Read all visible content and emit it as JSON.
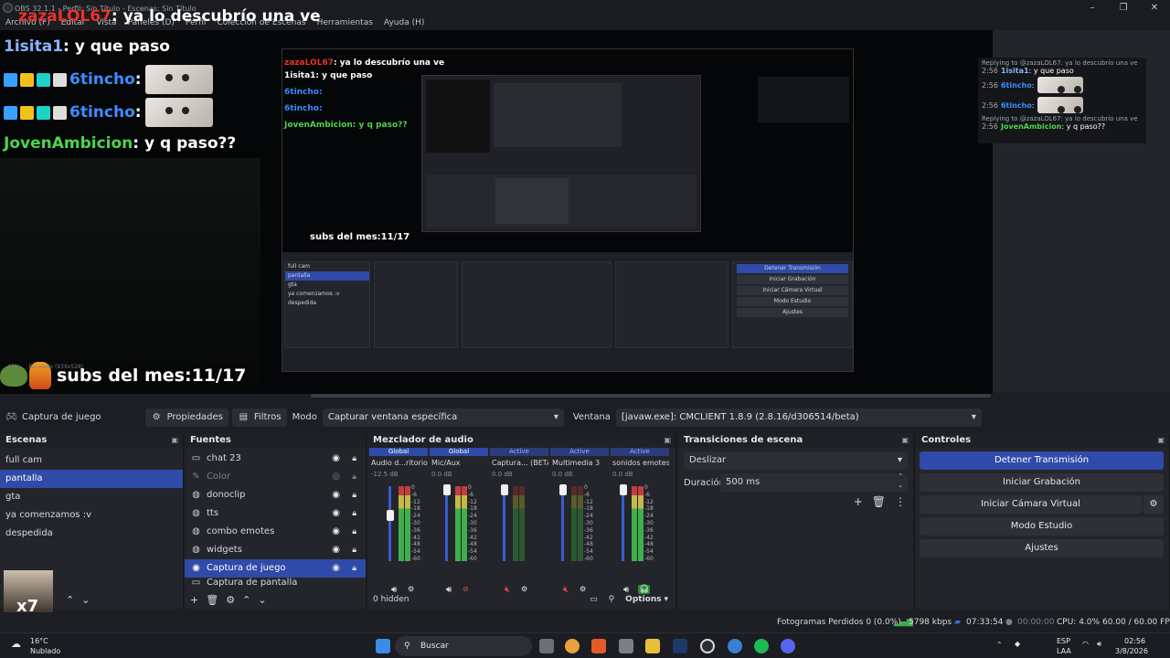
{
  "window": {
    "title": "OBS 32.1.1 - Perfil: Sin Título - Escenas: Sin Título"
  },
  "menu": [
    "Archivo (F)",
    "Editar",
    "Vista",
    "Paneles (D)",
    "Perfil",
    "Colección de Escenas",
    "Herramientas",
    "Ayuda (H)"
  ],
  "overlay": {
    "top_user": "zazaLOL67",
    "top_text": ": ya lo descubrío una ve",
    "chat": [
      {
        "user": "1isita1",
        "text": ": y que paso",
        "color": "#8ab4ff"
      },
      {
        "user": "6tincho",
        "text": ":",
        "color": "#3a8dff",
        "emote": true
      },
      {
        "user": "6tincho",
        "text": ":",
        "color": "#3a8dff",
        "emote": true
      },
      {
        "user": "JovenAmbicion",
        "text": ": y q paso??",
        "color": "#4fd34f"
      }
    ],
    "subs": "subs del mes:11/17"
  },
  "nested": {
    "chat": [
      "1isita1: y que paso",
      "6tincho:",
      "6tincho:",
      "JovenAmbicion: y q paso??"
    ],
    "subs": "subs del mes:11/17",
    "scenes": [
      "full cam",
      "pantalla",
      "gta",
      "ya comenzamos :v",
      "despedida"
    ],
    "controls": [
      "Detener Transmisión",
      "Iniciar Grabación",
      "Iniciar Cámara Virtual",
      "Modo Estudio",
      "Ajustes"
    ]
  },
  "right_chat": [
    {
      "reply": "Replying to @zazaLOL67: ya lo descubrío una ve"
    },
    {
      "time": "2:56",
      "user": "1isita1",
      "text": ": y que paso"
    },
    {
      "time": "2:56",
      "user": "6tincho",
      "text": ":"
    },
    {
      "time": "2:56",
      "user": "6tincho",
      "text": ":"
    },
    {
      "reply": "Replying to @zazaLOL67: ya lo descubrío una ve"
    },
    {
      "time": "2:56",
      "user": "JovenAmbicion",
      "text": ": y q paso??"
    }
  ],
  "preview_status": {
    "zoom": "48%",
    "scale": "Escalado (939x528)"
  },
  "toolbar": {
    "source_name": "Captura de juego",
    "properties": "Propiedades",
    "filters": "Filtros",
    "mode_label": "Modo",
    "mode_value": "Capturar ventana específica",
    "window_label": "Ventana",
    "window_value": "[javaw.exe]: CMCLIENT 1.8.9 (2.8.16/d306514/beta)"
  },
  "scenes": {
    "title": "Escenas",
    "items": [
      "full cam",
      "pantalla",
      "gta",
      "ya comenzamos :v",
      "despedida"
    ],
    "selected": 1,
    "webcam_label": "x7"
  },
  "sources": {
    "title": "Fuentes",
    "items": [
      {
        "name": "chat 23",
        "icon": "▭"
      },
      {
        "name": "Color",
        "icon": "✎"
      },
      {
        "name": "donoclip",
        "icon": "◍"
      },
      {
        "name": "tts",
        "icon": "◍"
      },
      {
        "name": "combo emotes",
        "icon": "◍"
      },
      {
        "name": "widgets",
        "icon": "◍"
      },
      {
        "name": "Captura de juego",
        "icon": "◉"
      },
      {
        "name": "Captura de pantalla",
        "icon": "▭"
      }
    ],
    "selected": 6
  },
  "mixer": {
    "title": "Mezclador de audio",
    "channels": [
      {
        "tag": "Global",
        "name": "Audio d...ritorio",
        "db": "-12.5 dB",
        "level": 0.72
      },
      {
        "tag": "Global",
        "name": "Mic/Aux",
        "db": "0.0 dB",
        "level": 1.0
      },
      {
        "tag": "Active",
        "name": "Captura... (BETA)",
        "db": "0.0 dB",
        "level": 1.0
      },
      {
        "tag": "Active",
        "name": "Multimedia 3",
        "db": "0.0 dB",
        "level": 1.0
      },
      {
        "tag": "Active",
        "name": "sonidos emotes",
        "db": "0.0 dB",
        "level": 1.0
      }
    ],
    "scale": [
      "0",
      "-6",
      "-12",
      "-18",
      "-24",
      "-30",
      "-36",
      "-42",
      "-48",
      "-54",
      "-60"
    ],
    "hidden": "0 hidden",
    "options": "Options"
  },
  "transitions": {
    "title": "Transiciones de escena",
    "type": "Deslizar",
    "duration_label": "Duración",
    "duration": "500 ms"
  },
  "controls": {
    "title": "Controles",
    "buttons": [
      "Detener Transmisión",
      "Iniciar Grabación",
      "Iniciar Cámara Virtual",
      "Modo Estudio",
      "Ajustes"
    ]
  },
  "status": {
    "dropped": "Fotogramas Perdidos 0 (0.0%)",
    "kbps": "5798 kbps",
    "stream_time": "07:33:54",
    "rec_time": "00:00:00",
    "cpu": "CPU: 4.0%",
    "fps": "60.00 / 60.00 FPS"
  },
  "taskbar": {
    "weather_temp": "16°C",
    "weather_desc": "Nublado",
    "search": "Buscar",
    "lang1": "ESP",
    "lang2": "LAA",
    "time": "02:56",
    "date": "3/8/2026"
  },
  "colors": {
    "accent": "#2f4aa8",
    "bg": "#1c1e23",
    "panel": "#23252b"
  }
}
